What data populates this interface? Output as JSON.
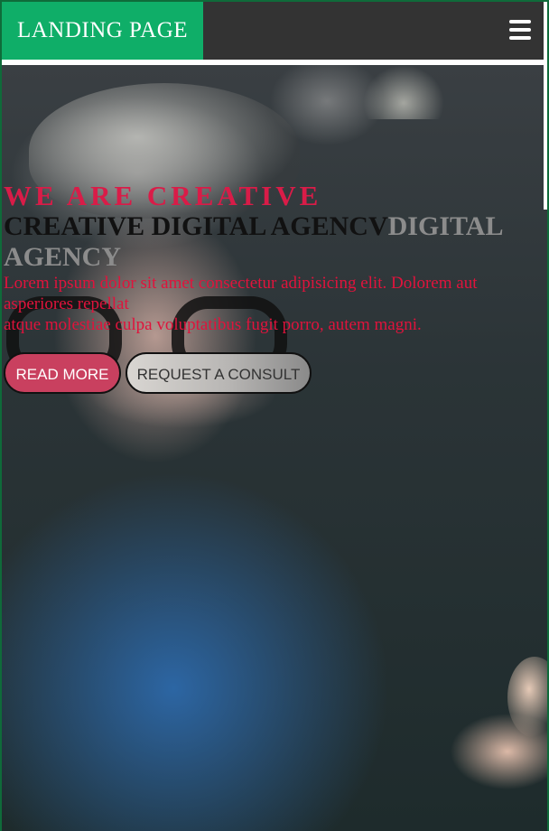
{
  "navbar": {
    "brand": "LANDING PAGE",
    "menu_icon": "hamburger-menu-icon"
  },
  "hero": {
    "eyebrow": "WE ARE CREATIVE",
    "headline_dark": "CREATIVE DIGITAL AGENCV",
    "headline_grey": "DIGITAL AGENCY",
    "lede_line1": "Lorem ipsum dolor sit amet consectetur adipisicing elit. Dolorem aut asperiores repellat",
    "lede_line2": "atque molestiae culpa voluptatibus fugit porro, autem magni.",
    "primary_button": "READ MORE",
    "secondary_button": "REQUEST A CONSULT"
  },
  "colors": {
    "brand_green": "#0fae68",
    "navbar_bg": "#333333",
    "accent_red": "#d91c48",
    "primary_button_bg": "#c9405f"
  }
}
